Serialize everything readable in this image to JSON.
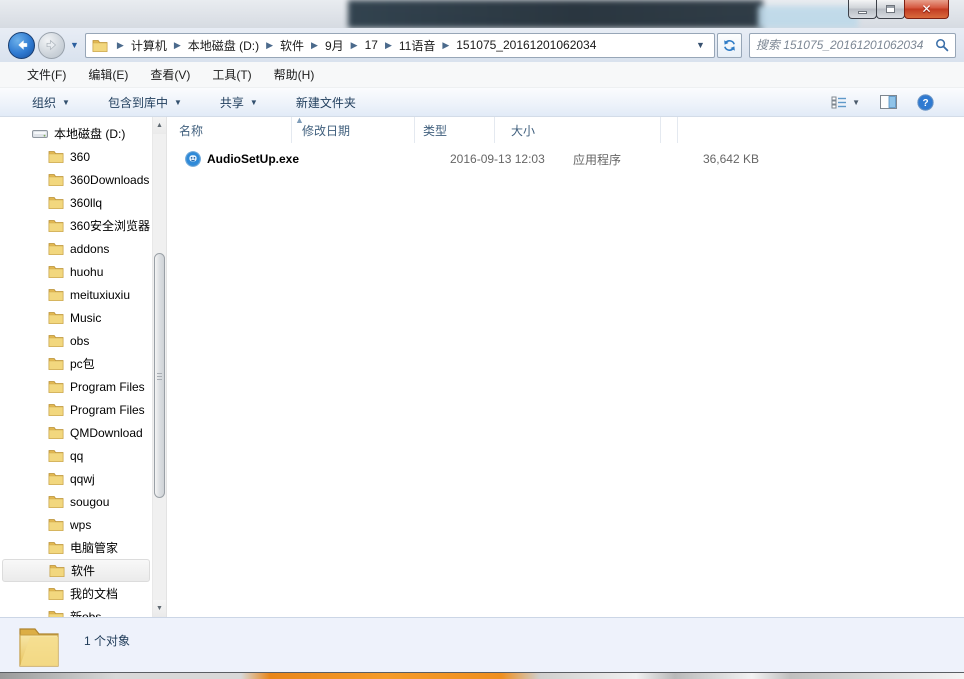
{
  "navbar": {
    "breadcrumb": {
      "segments": [
        "计算机",
        "本地磁盘 (D:)",
        "软件",
        "9月",
        "17",
        "11语音",
        "151075_20161201062034"
      ]
    },
    "search": {
      "placeholder": "搜索 151075_20161201062034"
    }
  },
  "menubar": {
    "items": [
      "文件(F)",
      "编辑(E)",
      "查看(V)",
      "工具(T)",
      "帮助(H)"
    ]
  },
  "toolbar": {
    "items": [
      {
        "label": "组织"
      },
      {
        "label": "包含到库中"
      },
      {
        "label": "共享"
      },
      {
        "label": "新建文件夹",
        "classes": [
          "no-arrow"
        ]
      }
    ]
  },
  "columns": [
    "名称",
    "修改日期",
    "类型",
    "大小",
    ""
  ],
  "files": [
    {
      "name": "AudioSetUp.exe",
      "date": "2016-09-13 12:03",
      "type": "应用程序",
      "size": "36,642 KB"
    }
  ],
  "sidebar": {
    "items": [
      {
        "label": "本地磁盘 (D:)",
        "classes": [
          "drive"
        ]
      },
      {
        "label": "360",
        "classes": [
          "folder"
        ]
      },
      {
        "label": "360Downloads",
        "classes": [
          "folder"
        ]
      },
      {
        "label": "360llq",
        "classes": [
          "folder"
        ]
      },
      {
        "label": "360安全浏览器",
        "classes": [
          "folder"
        ]
      },
      {
        "label": "addons",
        "classes": [
          "folder"
        ]
      },
      {
        "label": "huohu",
        "classes": [
          "folder"
        ]
      },
      {
        "label": "meituxiuxiu",
        "classes": [
          "folder"
        ]
      },
      {
        "label": "Music",
        "classes": [
          "folder"
        ]
      },
      {
        "label": "obs",
        "classes": [
          "folder"
        ]
      },
      {
        "label": "pc包",
        "classes": [
          "folder"
        ]
      },
      {
        "label": "Program Files",
        "classes": [
          "folder"
        ]
      },
      {
        "label": "Program Files",
        "classes": [
          "folder"
        ]
      },
      {
        "label": "QMDownload",
        "classes": [
          "folder"
        ]
      },
      {
        "label": "qq",
        "classes": [
          "folder"
        ]
      },
      {
        "label": "qqwj",
        "classes": [
          "folder"
        ]
      },
      {
        "label": "sougou",
        "classes": [
          "folder"
        ]
      },
      {
        "label": "wps",
        "classes": [
          "folder"
        ]
      },
      {
        "label": "电脑管家",
        "classes": [
          "folder"
        ]
      },
      {
        "label": "软件",
        "classes": [
          "folder",
          "selected"
        ]
      },
      {
        "label": "我的文档",
        "classes": [
          "folder"
        ]
      },
      {
        "label": "新obs",
        "classes": [
          "folder"
        ]
      }
    ]
  },
  "statusbar": {
    "text": "1 个对象"
  },
  "colors": {
    "close_button": "#c23a22",
    "folder_yellow": "#f2d77e",
    "toolbar_text": "#1f3d5c",
    "accent_blue": "#2f7ad1",
    "statusframe_orange": "#ef8f1f"
  }
}
